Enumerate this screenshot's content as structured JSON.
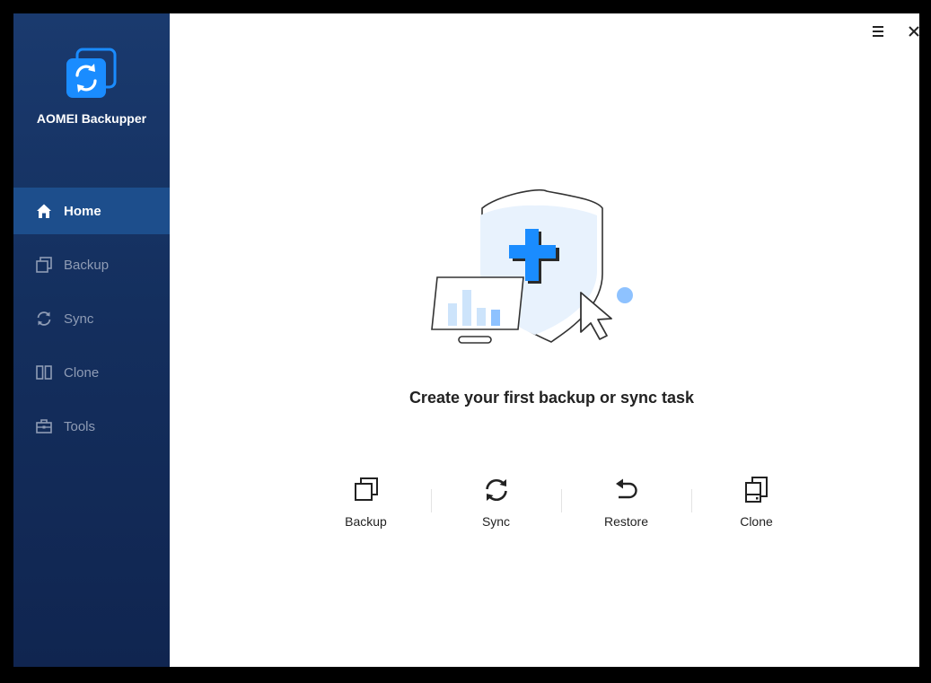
{
  "app": {
    "name": "AOMEI Backupper"
  },
  "sidebar": {
    "items": [
      {
        "label": "Home",
        "icon": "home-icon",
        "active": true
      },
      {
        "label": "Backup",
        "icon": "backup-icon",
        "active": false
      },
      {
        "label": "Sync",
        "icon": "sync-icon",
        "active": false
      },
      {
        "label": "Clone",
        "icon": "clone-icon",
        "active": false
      },
      {
        "label": "Tools",
        "icon": "tools-icon",
        "active": false
      }
    ]
  },
  "window_controls": {
    "menu_icon": "menu-icon",
    "close_icon": "close-icon"
  },
  "main": {
    "headline": "Create your first backup or sync task",
    "actions": [
      {
        "label": "Backup",
        "icon": "backup-icon"
      },
      {
        "label": "Sync",
        "icon": "sync-icon"
      },
      {
        "label": "Restore",
        "icon": "restore-icon"
      },
      {
        "label": "Clone",
        "icon": "clone-icon"
      }
    ]
  },
  "colors": {
    "sidebar_bg": "#142f5e",
    "active_item_bg": "#1d4e8c",
    "accent": "#1a8cff",
    "text_dark": "#222222",
    "inactive_text": "#8f9cb5"
  }
}
